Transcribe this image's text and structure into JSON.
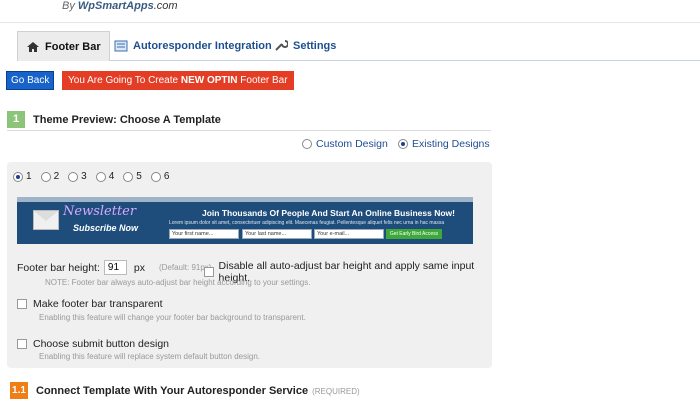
{
  "brand": {
    "by": "By",
    "wp": "WpSmartApps",
    "com": ".com"
  },
  "tabs": [
    {
      "label": "Footer Bar",
      "icon": "home-icon"
    },
    {
      "label": "Autoresponder Integration",
      "icon": "form-icon"
    },
    {
      "label": "Settings",
      "icon": "wrench-icon"
    }
  ],
  "actions": {
    "go_back": "Go Back",
    "notice_prefix": "You Are Going To Create ",
    "notice_bold": "NEW OPTIN",
    "notice_suffix": " Footer Bar"
  },
  "step1": {
    "number": "1",
    "title": "Theme Preview: Choose A Template"
  },
  "design": {
    "custom": "Custom Design",
    "existing": "Existing Designs",
    "selected": "Existing Designs"
  },
  "templates": {
    "options": [
      "1",
      "2",
      "3",
      "4",
      "5",
      "6"
    ],
    "selected": "1"
  },
  "preview": {
    "badge_title": "Newsletter",
    "badge_sub": "Subscribe Now",
    "headline": "Join Thousands Of People And Start An Online Business Now!",
    "small_text": "Lorem ipsum dolor sit amet, consectetuer adipiscing elit. Maecenas feugiat. Pellentesque aliquet felis nec urna in hac massa",
    "field_first": "Your first name...",
    "field_last": "Your last name...",
    "field_email": "Your e-mail...",
    "button": "Get Early Bird Access"
  },
  "footer_height": {
    "label": "Footer bar height:",
    "value": "91",
    "unit": "px",
    "default": "(Default: 91px)",
    "disable_label": "Disable all auto-adjust bar height and apply same input height.",
    "note": "NOTE: Footer bar always auto-adjust bar height according to your settings."
  },
  "options": {
    "transparent_label": "Make footer bar transparent",
    "transparent_desc": "Enabling this feature will change your footer bar background to transparent.",
    "submit_label": "Choose submit button design",
    "submit_desc": "Enabling this feature will replace system default button design."
  },
  "step11": {
    "number": "1.1",
    "title": "Connect Template With Your Autoresponder Service",
    "required": "(REQUIRED)"
  },
  "colors": {
    "accent_blue": "#1f4f8f",
    "go_back": "#1763c9",
    "notice_red": "#e43d25",
    "step_green": "#8cc47a",
    "step_orange": "#f07d16"
  }
}
